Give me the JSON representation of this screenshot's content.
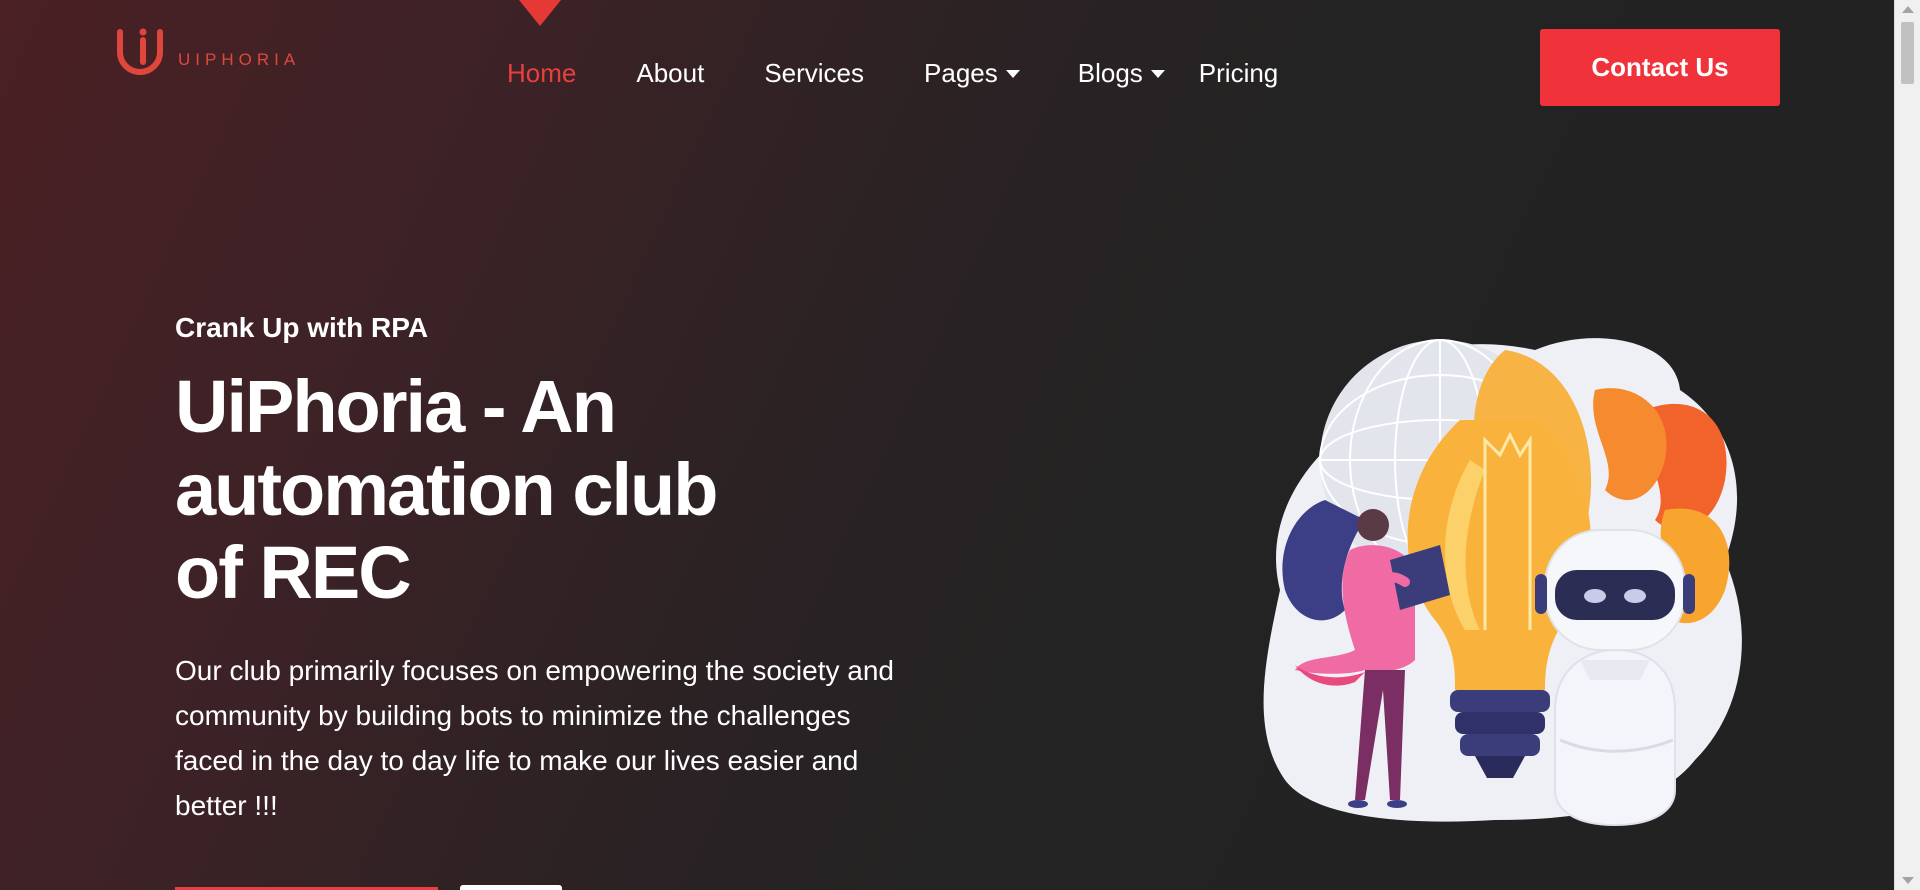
{
  "header": {
    "logo_text": "UIPHORIA",
    "nav": [
      {
        "label": "Home",
        "active": true,
        "has_dropdown": false
      },
      {
        "label": "About",
        "active": false,
        "has_dropdown": false
      },
      {
        "label": "Services",
        "active": false,
        "has_dropdown": false
      },
      {
        "label": "Pages",
        "active": false,
        "has_dropdown": true
      },
      {
        "label": "Blogs",
        "active": false,
        "has_dropdown": true
      },
      {
        "label": "Pricing",
        "active": false,
        "has_dropdown": false
      }
    ],
    "contact_label": "Contact Us"
  },
  "hero": {
    "kicker": "Crank Up with RPA",
    "headline": "UiPhoria - An automation club of REC",
    "description": "Our club primarily focuses on empowering the society and community by building bots to minimize the challenges faced in the day to day life to make our lives easier and better !!!"
  },
  "colors": {
    "accent": "#f0323b",
    "active_nav": "#e84040",
    "background_dark": "#222222",
    "background_warm": "#4a2024"
  },
  "icons": {
    "logo": "uiphoria-logo-icon",
    "dropdown": "caret-down-icon",
    "illustration": "robot-lightbulb-illustration"
  }
}
